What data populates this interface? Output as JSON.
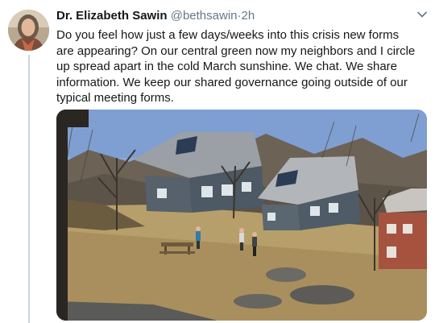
{
  "tweet": {
    "author_name": "Dr. Elizabeth Sawin",
    "handle": "@bethsawin",
    "separator": "·",
    "time": "2h",
    "text": "Do you feel how just a few days/weeks into this crisis new forms are appearing? On our central green now my neighbors and I circle up spread apart in the cold March sunshine. We chat. We share information. We keep our shared governance going outside of our typical meeting forms.",
    "avatar_icon": "profile-photo",
    "menu_icon": "chevron-down-icon",
    "media": {
      "description_icon": "photo"
    }
  },
  "colors": {
    "text": "#14171a",
    "secondary": "#657786",
    "divider": "#ccd6dd"
  }
}
